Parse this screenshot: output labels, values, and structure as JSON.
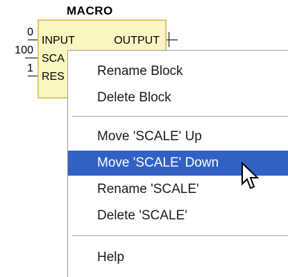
{
  "block": {
    "title": "MACRO",
    "pins": {
      "input": "INPUT",
      "scale": "SCA",
      "reset": "RES",
      "output": "OUTPUT"
    },
    "input_values": {
      "input": "0",
      "scale": "100",
      "reset": "1"
    }
  },
  "context_menu": {
    "items": [
      {
        "label": "Rename Block"
      },
      {
        "label": "Delete Block"
      },
      {
        "label": "Move 'SCALE' Up"
      },
      {
        "label": "Move 'SCALE' Down",
        "selected": true
      },
      {
        "label": "Rename 'SCALE'"
      },
      {
        "label": "Delete 'SCALE'"
      },
      {
        "label": "Help"
      }
    ]
  },
  "colors": {
    "block_fill": "#fbf5c2",
    "block_border": "#e2c56c",
    "menu_highlight": "#3161c4"
  },
  "cursor": "arrow-pointer-icon"
}
